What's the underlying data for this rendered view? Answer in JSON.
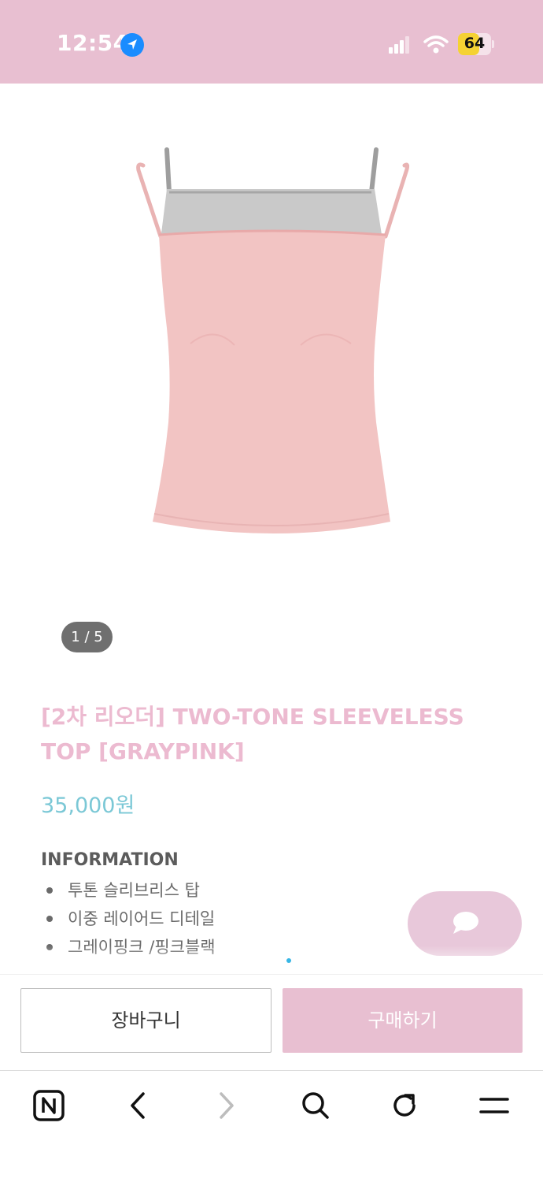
{
  "status_bar": {
    "time": "12:54",
    "battery_level": "64",
    "battery_fraction": 0.64,
    "icons": [
      "location-arrow-icon",
      "cellular-signal-icon",
      "wifi-icon",
      "battery-icon"
    ]
  },
  "colors": {
    "brand_pink": "#e8bfd1",
    "title_pink": "#ecbad0",
    "price_teal": "#7bc8d6"
  },
  "gallery": {
    "image": "two-tone pink and gray sleeveless camisole top",
    "counter": "1 / 5"
  },
  "product": {
    "title": "[2차 리오더] TWO-TONE SLEEVELESS TOP [GRAYPINK]",
    "price": "35,000원",
    "info_heading": "INFORMATION",
    "info_items": [
      "투톤 슬리브리스 탑",
      "이중 레이어드 디테일",
      "그레이핑크 /핑크블랙"
    ]
  },
  "floating_chat": {
    "icon": "chat-bubble-icon"
  },
  "purchase_bar": {
    "cart_label": "장바구니",
    "buy_label": "구매하기"
  },
  "browser_toolbar": {
    "icons": [
      "naver-home-icon",
      "back-icon",
      "forward-icon",
      "search-icon",
      "reload-icon",
      "menu-icon"
    ]
  }
}
